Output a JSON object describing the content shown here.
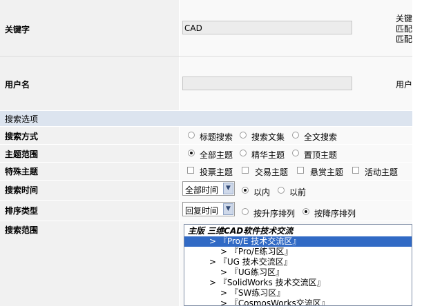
{
  "keyword": {
    "label": "关键字",
    "value": "CAD",
    "hint_lines": [
      "关键",
      "匹配",
      "匹配"
    ]
  },
  "username": {
    "label": "用户名",
    "value": "",
    "hint": "用户"
  },
  "section_title": "搜索选项",
  "search_mode": {
    "label": "搜索方式",
    "options": [
      "标题搜索",
      "搜索文集",
      "全文搜索"
    ],
    "selected": null
  },
  "topic_range": {
    "label": "主题范围",
    "options": [
      "全部主题",
      "精华主题",
      "置顶主题"
    ],
    "selected": "全部主题"
  },
  "special_topic": {
    "label": "特殊主题",
    "options": [
      "投票主题",
      "交易主题",
      "悬赏主题",
      "活动主题"
    ]
  },
  "search_time": {
    "label": "搜索时间",
    "select_value": "全部时间",
    "options": [
      "以内",
      "以前"
    ],
    "selected": "以内"
  },
  "sort_type": {
    "label": "排序类型",
    "select_value": "回复时间",
    "options": [
      "按升序排列",
      "按降序排列"
    ],
    "selected": "按降序排列"
  },
  "search_scope": {
    "label": "搜索范围",
    "items": [
      "主版 三维CAD软件技术交流",
      "> 『Pro/E 技术交流区』",
      "> 『Pro/E练习区』",
      "> 『UG 技术交流区』",
      "> 『UG练习区』",
      "> 『SolidWorks 技术交流区』",
      "> 『SW练习区』",
      "> 『CosmosWorks交流区』"
    ],
    "highlighted_index": 1
  }
}
